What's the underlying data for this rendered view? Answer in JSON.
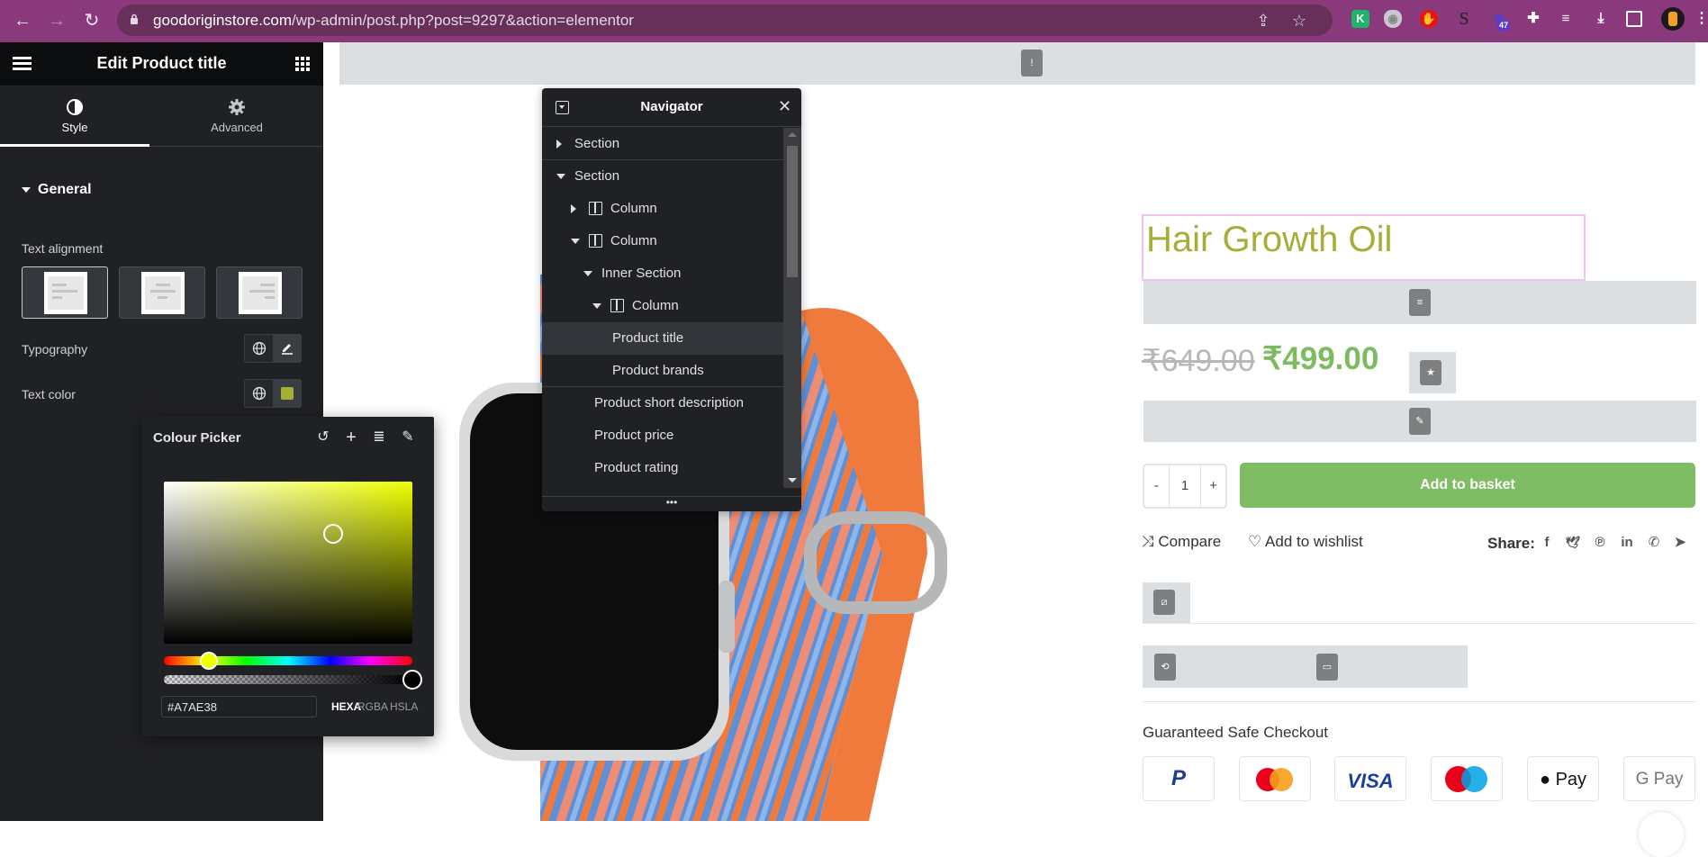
{
  "browser": {
    "url_host": "goodoriginstore.com",
    "url_path": "/wp-admin/post.php?post=9297&action=elementor",
    "extension_badge": "47",
    "icons": [
      "back-icon",
      "forward-icon",
      "reload-icon",
      "lock-icon",
      "share-icon",
      "bookmark-star-icon",
      "k-extension-icon",
      "shield-extension-icon",
      "adblock-extension-icon",
      "s-extension-icon",
      "extension-47-icon",
      "puzzle-extensions-icon",
      "media-queue-icon",
      "download-icon",
      "side-panel-icon",
      "profile-avatar",
      "menu-dots-icon"
    ]
  },
  "panel": {
    "title": "Edit Product title",
    "tabs": [
      {
        "label": "Style",
        "icon": "contrast-icon",
        "active": true
      },
      {
        "label": "Advanced",
        "icon": "gear-icon",
        "active": false
      }
    ],
    "section": "General",
    "text_alignment_label": "Text alignment",
    "alignment_options": [
      "left",
      "center",
      "right"
    ],
    "alignment_selected": "left",
    "typography_label": "Typography",
    "text_color_label": "Text color",
    "text_color_value": "#A7AE38"
  },
  "color_picker": {
    "title": "Colour Picker",
    "tools": [
      "reset-icon",
      "add-icon",
      "database-icon",
      "eyedropper-icon"
    ],
    "hex_value": "#A7AE38",
    "formats": [
      "HEXA",
      "RGBA",
      "HSLA"
    ],
    "active_format": "HEXA",
    "hue_color": "#EEFF00",
    "saturation": 0.68,
    "value": 0.68,
    "hue_fraction": 0.18,
    "alpha": 1.0
  },
  "navigator": {
    "title": "Navigator",
    "items": [
      {
        "label": "Section",
        "depth": 0,
        "arrow": "right",
        "column_icon": false,
        "bordered": true
      },
      {
        "label": "Section",
        "depth": 0,
        "arrow": "down",
        "column_icon": false,
        "bordered": false
      },
      {
        "label": "Column",
        "depth": 1,
        "arrow": "right",
        "column_icon": true,
        "bordered": false
      },
      {
        "label": "Column",
        "depth": 1,
        "arrow": "down",
        "column_icon": true,
        "bordered": false
      },
      {
        "label": "Inner Section",
        "depth": 2,
        "arrow": "down",
        "column_icon": false,
        "bordered": false
      },
      {
        "label": "Column",
        "depth": 3,
        "arrow": "down",
        "column_icon": true,
        "bordered": false
      },
      {
        "label": "Product title",
        "depth": 4,
        "arrow": null,
        "column_icon": false,
        "bordered": false,
        "selected": true
      },
      {
        "label": "Product brands",
        "depth": 4,
        "arrow": null,
        "column_icon": false,
        "bordered": true
      },
      {
        "label": "Product short description",
        "depth": 3,
        "arrow": null,
        "column_icon": false,
        "bordered": false
      },
      {
        "label": "Product price",
        "depth": 3,
        "arrow": null,
        "column_icon": false,
        "bordered": false
      },
      {
        "label": "Product rating",
        "depth": 3,
        "arrow": null,
        "column_icon": false,
        "bordered": false
      }
    ],
    "footer": "•••"
  },
  "product": {
    "title": "Hair Growth Oil",
    "title_color": "#A7AE38",
    "price_old": "₹649.00",
    "price_new": "₹499.00",
    "quantity": "1",
    "qty_minus": "-",
    "qty_plus": "+",
    "add_to_basket": "Add to basket",
    "compare": "Compare",
    "wishlist": "Add to wishlist",
    "share_label": "Share:",
    "social": [
      {
        "name": "facebook-icon",
        "glyph": "f"
      },
      {
        "name": "twitter-icon",
        "glyph": "🐦"
      },
      {
        "name": "pinterest-icon",
        "glyph": "℗"
      },
      {
        "name": "linkedin-icon",
        "glyph": "in"
      },
      {
        "name": "whatsapp-icon",
        "glyph": "✆"
      },
      {
        "name": "telegram-icon",
        "glyph": "➤"
      }
    ],
    "checkout_title": "Guaranteed Safe Checkout",
    "payment_methods": [
      {
        "name": "paypal",
        "label": "P"
      },
      {
        "name": "mastercard",
        "label": ""
      },
      {
        "name": "visa",
        "label": "VISA"
      },
      {
        "name": "maestro",
        "label": ""
      },
      {
        "name": "apple-pay",
        "label": " Pay"
      },
      {
        "name": "google-pay",
        "label": "G Pay"
      }
    ]
  }
}
